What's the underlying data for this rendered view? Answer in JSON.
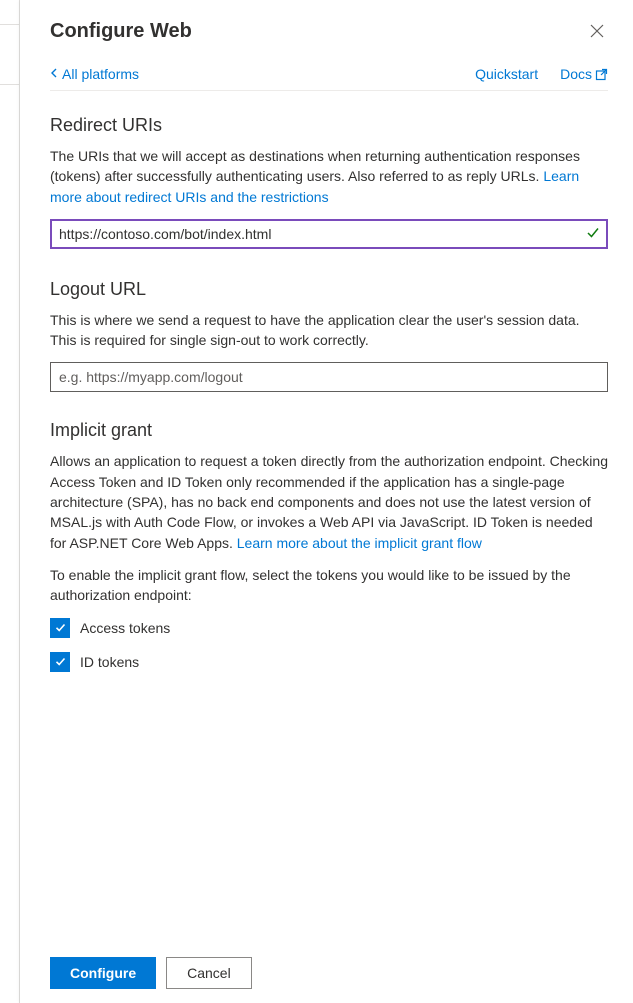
{
  "header": {
    "title": "Configure Web"
  },
  "nav": {
    "back_label": "All platforms",
    "quickstart_label": "Quickstart",
    "docs_label": "Docs"
  },
  "sections": {
    "redirect": {
      "title": "Redirect URIs",
      "desc_pre": "The URIs that we will accept as destinations when returning authentication responses (tokens) after successfully authenticating users. Also referred to as reply URLs. ",
      "learn_more": "Learn more about redirect URIs and the restrictions",
      "input_value": "https://contoso.com/bot/index.html"
    },
    "logout": {
      "title": "Logout URL",
      "desc": "This is where we send a request to have the application clear the user's session data. This is required for single sign-out to work correctly.",
      "placeholder": "e.g. https://myapp.com/logout",
      "input_value": ""
    },
    "implicit": {
      "title": "Implicit grant",
      "desc_pre": "Allows an application to request a token directly from the authorization endpoint. Checking Access Token and ID Token only recommended if the application has a single-page architecture (SPA), has no back end components and does not use the latest version of MSAL.js with Auth Code Flow, or invokes a Web API via JavaScript. ID Token is needed for ASP.NET Core Web Apps. ",
      "learn_more": "Learn more about the implicit grant flow",
      "enable_text": "To enable the implicit grant flow, select the tokens you would like to be issued by the authorization endpoint:",
      "access_tokens_label": "Access tokens",
      "id_tokens_label": "ID tokens",
      "access_tokens_checked": true,
      "id_tokens_checked": true
    }
  },
  "footer": {
    "configure_label": "Configure",
    "cancel_label": "Cancel"
  }
}
